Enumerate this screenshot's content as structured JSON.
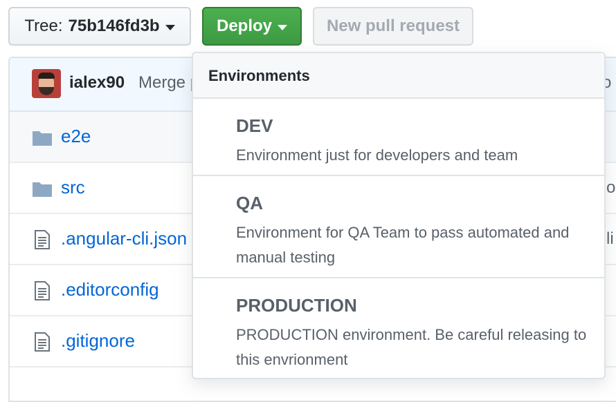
{
  "toolbar": {
    "tree_label": "Tree:",
    "tree_value": "75b146fd3b",
    "deploy_label": "Deploy",
    "new_pr_label": "New pull request"
  },
  "commit": {
    "author": "ialex90",
    "message": "Merge pu",
    "right_fragment": "o"
  },
  "files": [
    {
      "name": "e2e",
      "type": "folder",
      "extra": ""
    },
    {
      "name": "src",
      "type": "folder",
      "extra": "so"
    },
    {
      "name": ".angular-cli.json",
      "type": "file",
      "extra": "sli"
    },
    {
      "name": ".editorconfig",
      "type": "file",
      "extra": ""
    },
    {
      "name": ".gitignore",
      "type": "file",
      "extra": ""
    }
  ],
  "dropdown": {
    "title": "Environments",
    "environments": [
      {
        "name": "DEV",
        "description": "Environment just for developers and team"
      },
      {
        "name": "QA",
        "description": "Environment for QA Team to pass automated and manual testing"
      },
      {
        "name": "PRODUCTION",
        "description": "PRODUCTION environment. Be careful releasing to this envrionment"
      }
    ]
  },
  "colors": {
    "deploy_green": "#4caf50",
    "link_blue": "#0366d6",
    "commit_bg": "#f1f8ff",
    "folder_icon": "#79b8ff"
  }
}
